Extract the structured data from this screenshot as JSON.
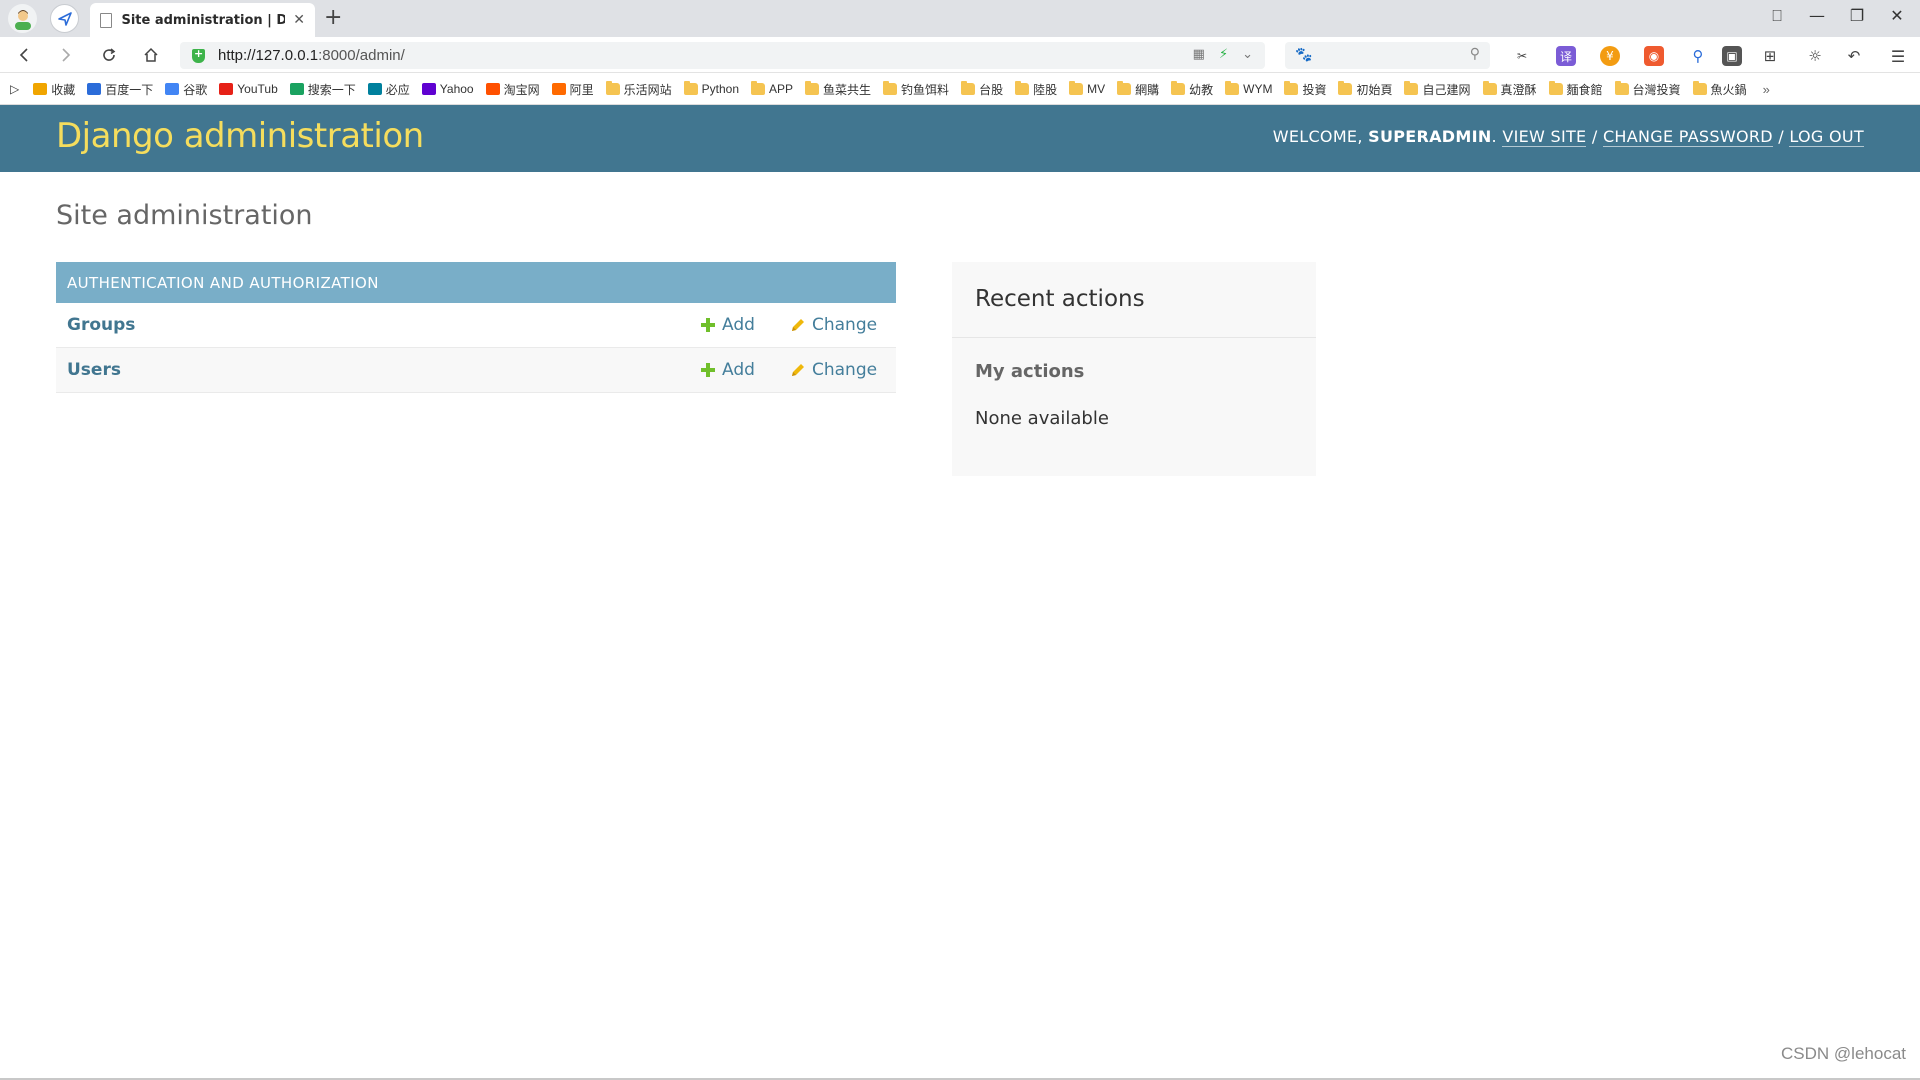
{
  "browser": {
    "tab_title": "Site administration | Djang",
    "new_tab_symbol": "+",
    "url_host": "http://127.0.0.1",
    "url_rest": ":8000/admin/",
    "window_controls": [
      "⎕",
      "—",
      "❐",
      "✕"
    ],
    "bookmarks": [
      {
        "label": "收藏",
        "icon": "star-icon",
        "color": "#f0a500"
      },
      {
        "label": "百度一下",
        "icon": "baidu-icon",
        "color": "#2b6cd9"
      },
      {
        "label": "谷歌",
        "icon": "google-icon",
        "color": "#4285f4"
      },
      {
        "label": "YouTub",
        "icon": "youtube-icon",
        "color": "#e62117"
      },
      {
        "label": "搜索一下",
        "icon": "search-logo-icon",
        "color": "#1aa260"
      },
      {
        "label": "必应",
        "icon": "bing-icon",
        "color": "#00809d"
      },
      {
        "label": "Yahoo",
        "icon": "yahoo-icon",
        "color": "#5f01d1"
      },
      {
        "label": "淘宝网",
        "icon": "taobao-icon",
        "color": "#ff5000"
      },
      {
        "label": "阿里",
        "icon": "ali-icon",
        "color": "#ff6a00"
      },
      {
        "label": "乐活网站",
        "icon": "folder-icon",
        "color": "#f5c451"
      },
      {
        "label": "Python",
        "icon": "folder-icon",
        "color": "#f5c451"
      },
      {
        "label": "APP",
        "icon": "folder-icon",
        "color": "#f5c451"
      },
      {
        "label": "鱼菜共生",
        "icon": "folder-icon",
        "color": "#f5c451"
      },
      {
        "label": "钓鱼饵料",
        "icon": "folder-icon",
        "color": "#f5c451"
      },
      {
        "label": "台股",
        "icon": "folder-icon",
        "color": "#f5c451"
      },
      {
        "label": "陸股",
        "icon": "folder-icon",
        "color": "#f5c451"
      },
      {
        "label": "MV",
        "icon": "folder-icon",
        "color": "#f5c451"
      },
      {
        "label": "網購",
        "icon": "folder-icon",
        "color": "#f5c451"
      },
      {
        "label": "幼教",
        "icon": "folder-icon",
        "color": "#f5c451"
      },
      {
        "label": "WYM",
        "icon": "folder-icon",
        "color": "#f5c451"
      },
      {
        "label": "投資",
        "icon": "folder-icon",
        "color": "#f5c451"
      },
      {
        "label": "初始頁",
        "icon": "folder-icon",
        "color": "#f5c451"
      },
      {
        "label": "自己建网",
        "icon": "folder-icon",
        "color": "#f5c451"
      },
      {
        "label": "真澄酥",
        "icon": "folder-icon",
        "color": "#f5c451"
      },
      {
        "label": "麵食館",
        "icon": "folder-icon",
        "color": "#f5c451"
      },
      {
        "label": "台灣投資",
        "icon": "folder-icon",
        "color": "#f5c451"
      },
      {
        "label": "魚火鍋",
        "icon": "folder-icon",
        "color": "#f5c451"
      }
    ],
    "bookmarks_more": "»"
  },
  "django": {
    "branding": "Django administration",
    "welcome": "WELCOME,",
    "username": "SUPERADMIN",
    "view_site": "VIEW SITE",
    "change_password": "CHANGE PASSWORD",
    "log_out": "LOG OUT",
    "separator": "/",
    "page_heading": "Site administration",
    "app_caption": "AUTHENTICATION AND AUTHORIZATION",
    "models": [
      {
        "name": "Groups",
        "add": "Add",
        "change": "Change"
      },
      {
        "name": "Users",
        "add": "Add",
        "change": "Change"
      }
    ],
    "recent_actions_title": "Recent actions",
    "my_actions": "My actions",
    "none_available": "None available"
  },
  "watermark": "CSDN @lehocat",
  "colors": {
    "header_bg": "#417690",
    "branding": "#f5dd5d",
    "caption_bg": "#79aec8",
    "link": "#447e9b",
    "add_green": "#70bf2b",
    "pencil_yellow": "#efb80b"
  }
}
